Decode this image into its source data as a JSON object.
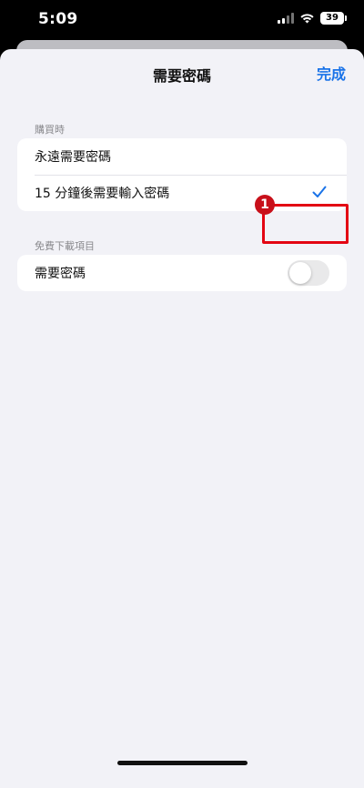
{
  "status_bar": {
    "time": "5:09",
    "battery": "39",
    "icons": [
      "signal-icon",
      "wifi-icon",
      "battery-icon"
    ]
  },
  "nav": {
    "title": "需要密碼",
    "done_label": "完成"
  },
  "sections": [
    {
      "header": "購買時",
      "items": [
        {
          "label": "永遠需要密碼",
          "checked": false
        },
        {
          "label": "15 分鐘後需要輸入密碼",
          "checked": true
        }
      ]
    },
    {
      "header": "免費下載項目",
      "items": [
        {
          "label": "需要密碼",
          "toggle_on": false
        }
      ]
    }
  ],
  "annotation": {
    "step_number": "1",
    "color": "#e30613"
  },
  "colors": {
    "accent": "#1a73e8",
    "background": "#f2f2f7"
  }
}
